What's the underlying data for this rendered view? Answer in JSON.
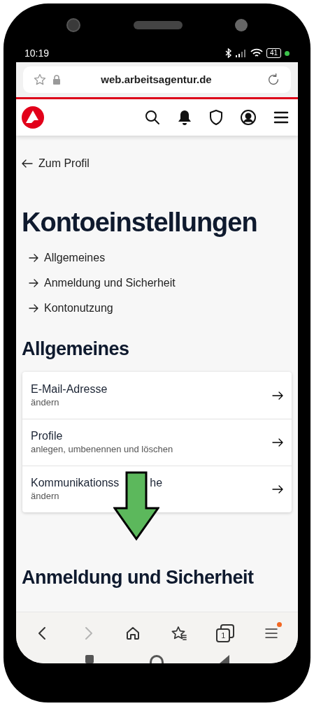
{
  "status_bar": {
    "time": "10:19",
    "battery": "41"
  },
  "browser": {
    "url": "web.arbeitsagentur.de"
  },
  "back_link": "Zum Profil",
  "title": "Kontoeinstellungen",
  "toc": [
    "Allgemeines",
    "Anmeldung und Sicherheit",
    "Kontonutzung"
  ],
  "sections": [
    {
      "heading": "Allgemeines",
      "rows": [
        {
          "title_parts": [
            "E-Mail-Adresse"
          ],
          "subtitle": "ändern"
        },
        {
          "title_parts": [
            "Profile"
          ],
          "subtitle": "anlegen, umbenennen und löschen"
        },
        {
          "title_parts": [
            "Kommunikationss",
            "he"
          ],
          "subtitle": "ändern"
        }
      ]
    },
    {
      "heading": "Anmeldung und Sicherheit"
    }
  ],
  "bottom_nav": [
    {
      "kind": "back",
      "disabled": false
    },
    {
      "kind": "forward",
      "disabled": true
    },
    {
      "kind": "home",
      "disabled": false
    },
    {
      "kind": "bookmarks",
      "disabled": false
    },
    {
      "kind": "tabs",
      "disabled": false,
      "tab_count": "1"
    },
    {
      "kind": "menu",
      "disabled": false,
      "badge": true
    }
  ]
}
